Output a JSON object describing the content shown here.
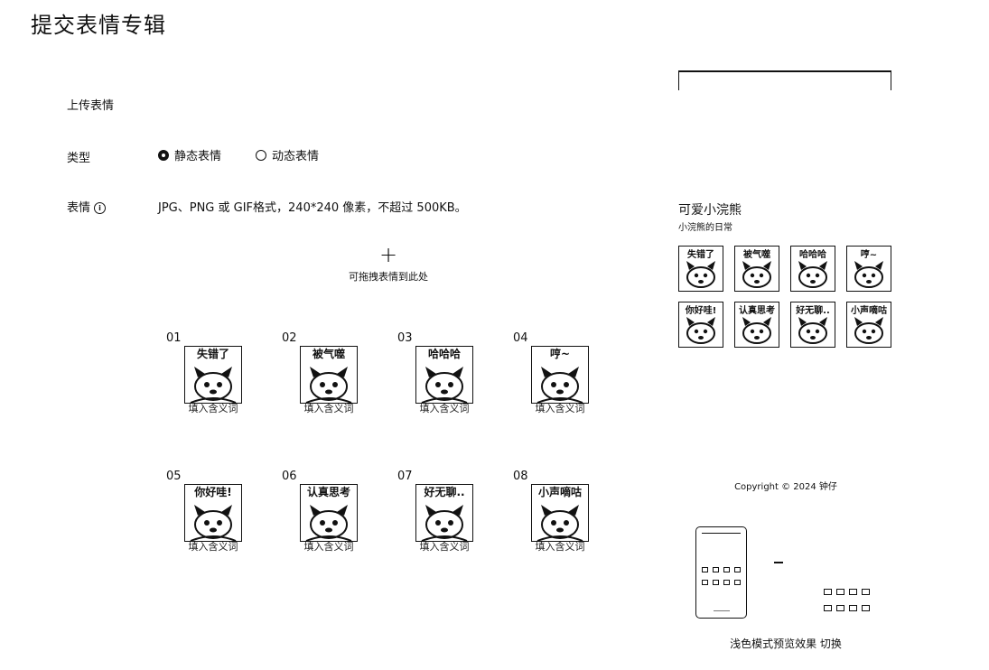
{
  "page": {
    "title": "提交表情专辑"
  },
  "form": {
    "upload_label": "上传表情",
    "type_label": "类型",
    "type_options": [
      {
        "label": "静态表情",
        "selected": true
      },
      {
        "label": "动态表情",
        "selected": false
      }
    ],
    "emoji_label": "表情",
    "format_hint": "JPG、PNG 或 GIF格式，240*240 像素，不超过 500KB。",
    "dropzone_text": "可拖拽表情到此处"
  },
  "stickers": [
    {
      "num": "01",
      "caption": "失错了",
      "meaning_placeholder": "填入含义词"
    },
    {
      "num": "02",
      "caption": "被气噬",
      "meaning_placeholder": "填入含义词"
    },
    {
      "num": "03",
      "caption": "哈哈哈",
      "meaning_placeholder": "填入含义词"
    },
    {
      "num": "04",
      "caption": "哼~",
      "meaning_placeholder": "填入含义词"
    },
    {
      "num": "05",
      "caption": "你好哇!",
      "meaning_placeholder": "填入含义词"
    },
    {
      "num": "06",
      "caption": "认真思考",
      "meaning_placeholder": "填入含义词"
    },
    {
      "num": "07",
      "caption": "好无聊..",
      "meaning_placeholder": "填入含义词"
    },
    {
      "num": "08",
      "caption": "小声嘀咕",
      "meaning_placeholder": "填入含义词"
    }
  ],
  "preview": {
    "pack_title": "可爱小浣熊",
    "pack_subtitle": "小浣熊的日常",
    "copyright": "Copyright © 2024 钟仔",
    "theme_text": "浅色模式预览效果",
    "theme_switch": "切换"
  }
}
